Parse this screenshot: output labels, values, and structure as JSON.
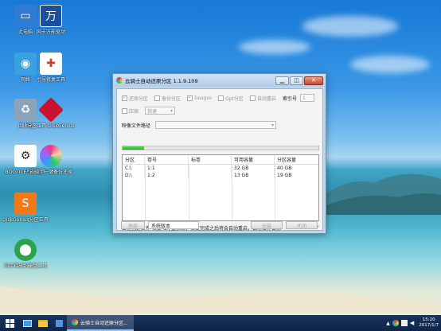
{
  "desktop": {
    "icons": [
      {
        "label": "此电脑",
        "icon": "computer-icon",
        "color": "#2f7bd6"
      },
      {
        "label": "网卡万能驱动",
        "icon": "wan-driver-icon",
        "color": "#1b4f9c"
      },
      {
        "label": "网络",
        "icon": "network-icon",
        "color": "#3aa0e0"
      },
      {
        "label": "引导修复工具",
        "icon": "boot-repair-icon",
        "color": "#d33a2f"
      },
      {
        "label": "回收站",
        "icon": "recycle-bin-icon",
        "color": "#8aa3b8"
      },
      {
        "label": "分区工具 DiskGenius",
        "icon": "diskgenius-icon",
        "color": "#c8122e"
      },
      {
        "label": "BOOTICE引导工具",
        "icon": "bootice-icon",
        "color": "#222222"
      },
      {
        "label": "云骑士一键备份还原",
        "icon": "yunqishi-icon",
        "color": "#e8398b"
      },
      {
        "label": "DiskGenius分区工具",
        "icon": "diskgenius-orange-icon",
        "color": "#f07a1a"
      },
      {
        "label": "内存释放到硬盘工具",
        "icon": "memory-tool-icon",
        "color": "#2aa34a"
      }
    ]
  },
  "window": {
    "title": "云骑士自动还原分区 1.1.9.109",
    "minimize_icon": "minimize-icon",
    "restore_icon": "restore-icon",
    "close_label": "✕",
    "options": {
      "restore_partition": "还原分区",
      "backup_partition": "备份分区",
      "images": "Images",
      "gpt_partition": "Gpt分区",
      "auto_restart": "自动重启",
      "index_label": "索引号",
      "index_value": "1",
      "compress_label": "压缩",
      "compress_value": "快速"
    },
    "image_path_label": "映像文件路径",
    "progress": 0.11,
    "table": {
      "headers": [
        "分区",
        "卷号",
        "标卷",
        "可用容量",
        "分区容量"
      ],
      "rows": [
        [
          "C:\\",
          "1:1",
          "",
          "32 GB",
          "40 GB"
        ],
        [
          "D:\\",
          "1:2",
          "",
          "13 GB",
          "19 GB"
        ]
      ]
    },
    "status_text": "正在创建文件  恢复 C:\\ 盘系统，恢复完成之后将会自动重启，请勿操作鼠标",
    "buttons": {
      "browse": "高级",
      "version": "系统版本",
      "install": "安装",
      "close": "关闭"
    }
  },
  "taskbar": {
    "app_label": "云骑士自动还原分区...",
    "time": "15:20",
    "date": "2017/1/7"
  }
}
